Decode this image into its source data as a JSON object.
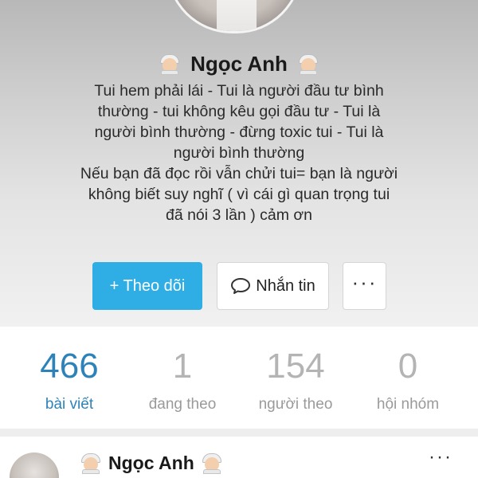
{
  "profile": {
    "name": "Ngọc Anh",
    "bio_lines": [
      "Tui hem phải lái - Tui là người đầu tư bình",
      "thường - tui không kêu gọi đầu tư - Tui là",
      "người bình thường - đừng toxic tui - Tui là",
      "người bình thường",
      "Nếu bạn đã đọc rồi vẫn chửi tui= bạn là người",
      "không biết suy nghĩ ( vì cái gì quan trọng tui",
      "đã nói 3 lần ) cảm ơn"
    ]
  },
  "actions": {
    "follow_label": "+ Theo dõi",
    "message_label": "Nhắn tin",
    "more_label": "···"
  },
  "stats": [
    {
      "value": "466",
      "label": "bài viết"
    },
    {
      "value": "1",
      "label": "đang theo"
    },
    {
      "value": "154",
      "label": "người theo"
    },
    {
      "value": "0",
      "label": "hội nhóm"
    }
  ],
  "post": {
    "author": "Ngọc Anh",
    "more_label": "···"
  },
  "colors": {
    "accent": "#2eaee4",
    "active_stat": "#2d83b9"
  },
  "icons": {
    "name_left": "bride-emoji-icon",
    "name_right": "bride-emoji-icon",
    "message": "chat-bubble-icon"
  }
}
